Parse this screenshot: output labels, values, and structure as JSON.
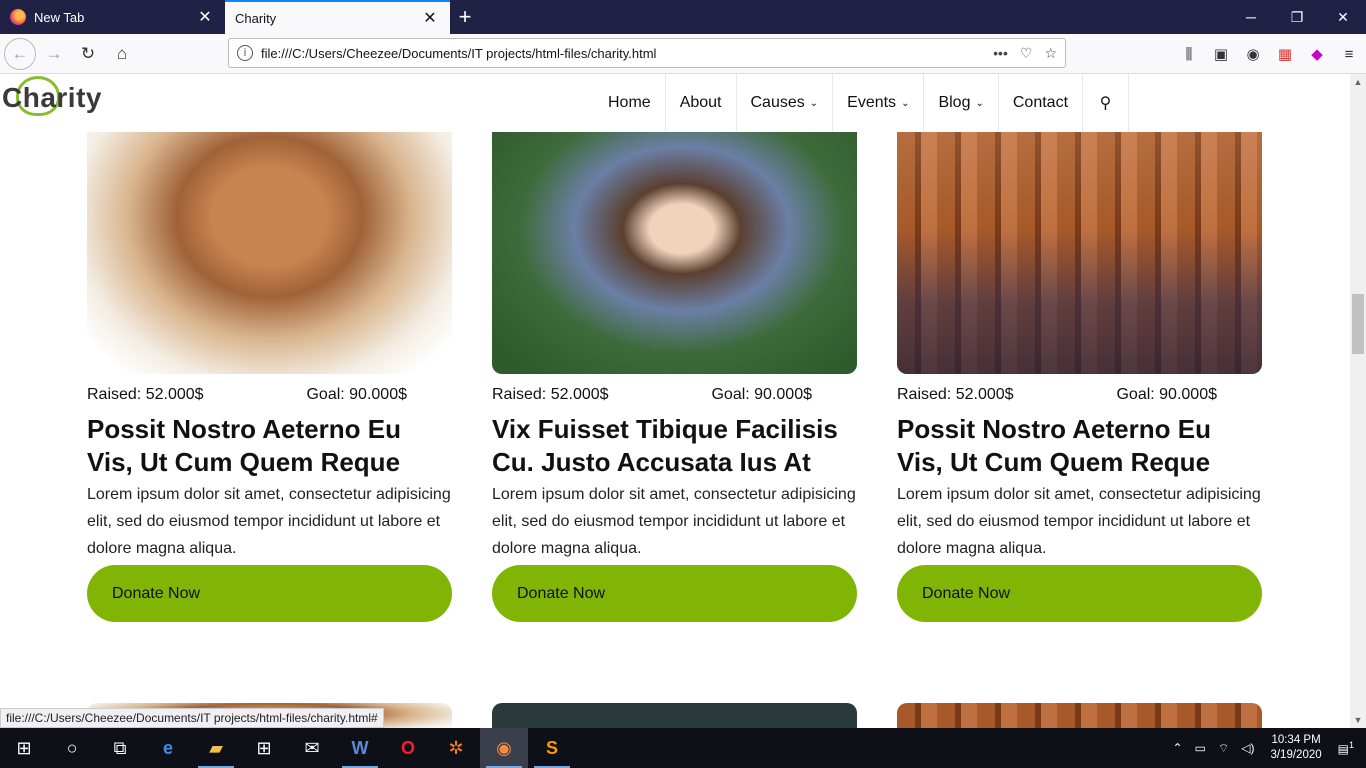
{
  "browser": {
    "tabs": [
      {
        "title": "New Tab",
        "active": false
      },
      {
        "title": "Charity",
        "active": true
      }
    ],
    "url": "file:///C:/Users/Cheezee/Documents/IT projects/html-files/charity.html",
    "status_url": "file:///C:/Users/Cheezee/Documents/IT projects/html-files/charity.html#"
  },
  "site": {
    "logo": "Charity",
    "menu": [
      {
        "label": "Home"
      },
      {
        "label": "About"
      },
      {
        "label": "Causes"
      },
      {
        "label": "Events"
      },
      {
        "label": "Blog"
      },
      {
        "label": "Contact"
      }
    ]
  },
  "cards": [
    {
      "raised": "Raised: 52.000$",
      "goal": "Goal: 90.000$",
      "title": "Possit Nostro Aeterno Eu Vis, Ut Cum Quem Reque",
      "text": "Lorem ipsum dolor sit amet, consectetur adipisicing elit, sed do eiusmod tempor incididunt ut labore et dolore magna aliqua.",
      "button": "Donate Now"
    },
    {
      "raised": "Raised: 52.000$",
      "goal": "Goal: 90.000$",
      "title": "Vix Fuisset Tibique Facilisis Cu. Justo Accusata Ius At",
      "text": "Lorem ipsum dolor sit amet, consectetur adipisicing elit, sed do eiusmod tempor incididunt ut labore et dolore magna aliqua.",
      "button": "Donate Now"
    },
    {
      "raised": "Raised: 52.000$",
      "goal": "Goal: 90.000$",
      "title": "Possit Nostro Aeterno Eu Vis, Ut Cum Quem Reque",
      "text": "Lorem ipsum dolor sit amet, consectetur adipisicing elit, sed do eiusmod tempor incididunt ut labore et dolore magna aliqua.",
      "button": "Donate Now"
    }
  ],
  "taskbar": {
    "time": "10:34 PM",
    "date": "3/19/2020",
    "notifications": "1"
  },
  "colors": {
    "accent": "#80b506",
    "tabbar": "#1f2245",
    "taskbar": "#0d1117"
  }
}
